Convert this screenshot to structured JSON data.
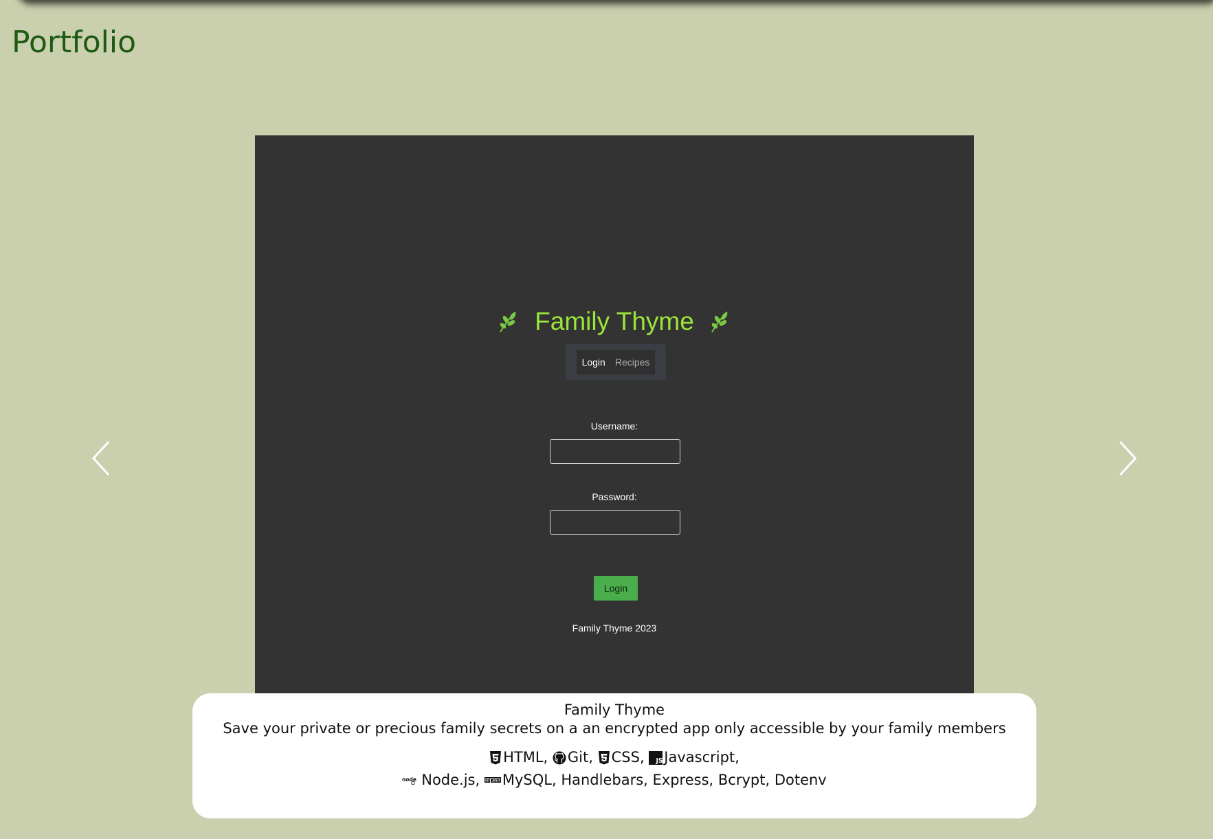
{
  "page": {
    "title": "Portfolio"
  },
  "carousel": {
    "prev_icon": "chevron-left-icon",
    "next_icon": "chevron-right-icon",
    "arrow_color": "#ffffff"
  },
  "slide": {
    "screenshot": {
      "app_title": "Family Thyme",
      "title_color": "#9be53a",
      "nav": {
        "login": "Login",
        "recipes": "Recipes"
      },
      "username_label": "Username:",
      "password_label": "Password:",
      "login_button": "Login",
      "footer": "Family Thyme 2023",
      "button_color": "#4aae4d"
    },
    "caption": {
      "title": "Family Thyme",
      "description": "Save your private or precious family secrets on a an encrypted app only accessible by your family members",
      "technologies_line1": [
        {
          "name": "HTML",
          "icon": "html5-icon"
        },
        {
          "name": "Git",
          "icon": "github-icon"
        },
        {
          "name": "CSS",
          "icon": "css3-icon"
        },
        {
          "name": "Javascript",
          "icon": "javascript-icon"
        }
      ],
      "technologies_line2": [
        {
          "name": "Node.js",
          "icon": "nodejs-icon"
        },
        {
          "name": "MySQL",
          "icon": "npm-icon"
        },
        {
          "name": "Handlebars"
        },
        {
          "name": "Express"
        },
        {
          "name": "Bcrypt"
        },
        {
          "name": "Dotenv"
        }
      ]
    }
  }
}
